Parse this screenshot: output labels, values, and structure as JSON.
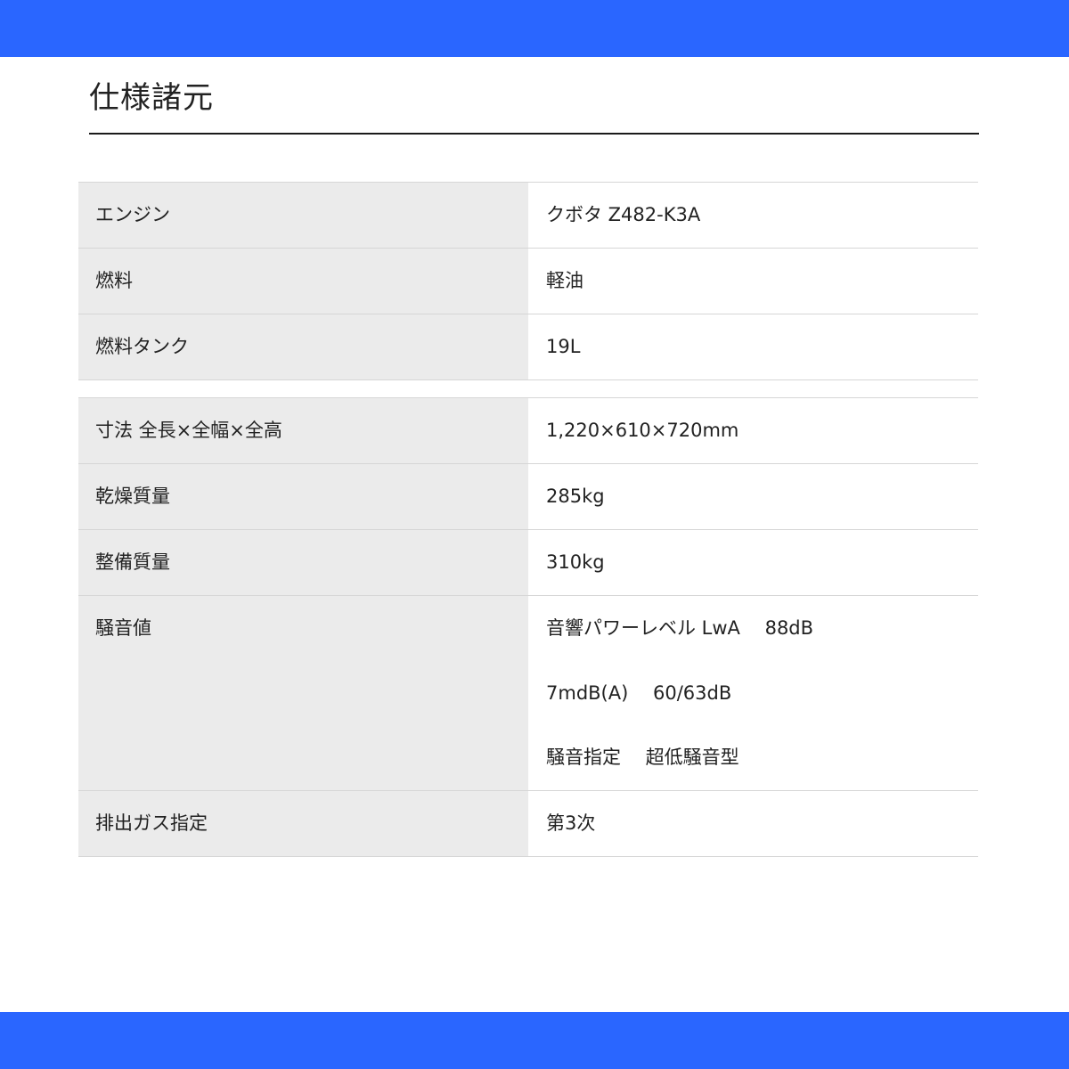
{
  "header": {
    "title": "仕様諸元"
  },
  "specs_group_1": [
    {
      "label": "エンジン",
      "value": "クボタ Z482-K3A"
    },
    {
      "label": "燃料",
      "value": "軽油"
    },
    {
      "label": "燃料タンク",
      "value": "19L"
    }
  ],
  "specs_group_2": [
    {
      "label": "寸法 全長×全幅×全高",
      "value": "1,220×610×720mm"
    },
    {
      "label": "乾燥質量",
      "value": "285kg"
    },
    {
      "label": "整備質量",
      "value": "310kg"
    },
    {
      "label": "騒音値",
      "values": [
        "音響パワーレベル LwA　 88dB",
        "7mdB(A)　 60/63dB",
        "騒音指定　 超低騒音型"
      ]
    },
    {
      "label": "排出ガス指定",
      "value": "第3次"
    }
  ],
  "colors": {
    "accent_bar": "#2a66ff",
    "label_background": "#ebebeb",
    "row_border": "#d6d6d6"
  }
}
